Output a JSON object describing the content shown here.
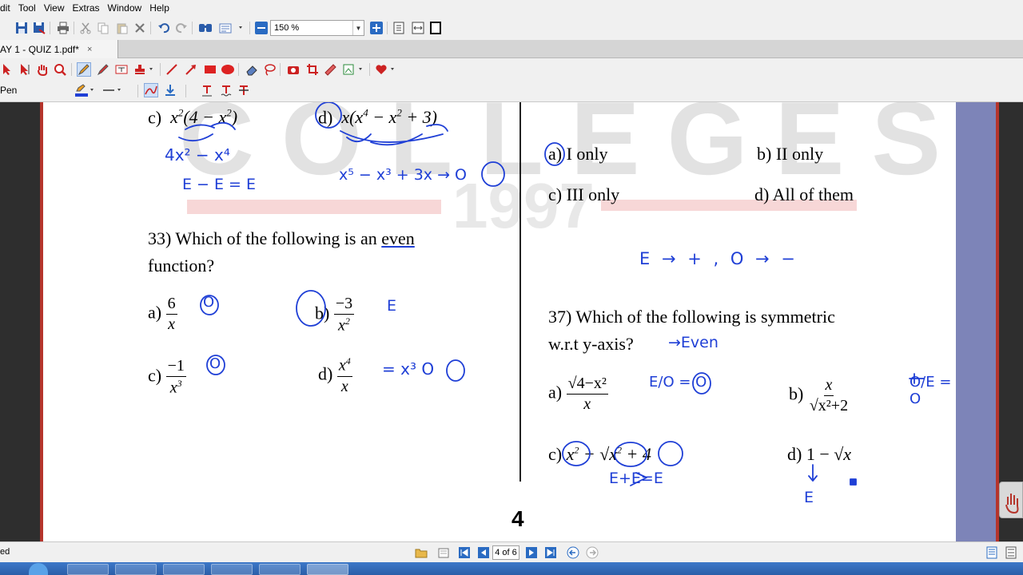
{
  "menu": [
    "Edit",
    "Tool",
    "View",
    "Extras",
    "Window",
    "Help"
  ],
  "menu_display": [
    "dit",
    "Tool",
    "View",
    "Extras",
    "Window",
    "Help"
  ],
  "zoom": "150 %",
  "tab": {
    "title": "AY 1 - QUIZ 1.pdf*",
    "close": "×"
  },
  "toolbar3": {
    "tool_label": "Pen"
  },
  "document": {
    "watermark_text": "COLLEGES",
    "watermark_year": "1997",
    "page_number": "4",
    "left": {
      "c_prev": "c)",
      "d_prev": "d)",
      "q33": "33) Which of the following is an",
      "q33_underlined": "even",
      "q33_line2": "function?",
      "a": "a)",
      "b": "b)",
      "c": "c)",
      "d": "d)",
      "a_num": "6",
      "b_num": "−3",
      "c_num": "−1",
      "d_num": "x",
      "hw_c_expand": "4x² − x⁴",
      "hw_c_parity": "E − E = E",
      "hw_d_expand": "x⁵ − x³ + 3x → O",
      "hw_a": "O",
      "hw_b": "E",
      "hw_c": "O",
      "hw_d": "= x³  O"
    },
    "right": {
      "opt_a": "a) I only",
      "opt_b": "b) II only",
      "opt_c": "c) III only",
      "opt_d": "d) All of them",
      "hw_rule": "E → +  , O → −",
      "q37": "37) Which of the following is symmetric",
      "q37_line2": "w.r.t y-axis?",
      "hw_even": "→Even",
      "a": "a)",
      "b": "b)",
      "c": "c)",
      "d": "d) 1 −",
      "a_num": "√4−x²",
      "a_den": "x",
      "b_num": "x",
      "b_den": "√x²+2",
      "hw_a": "E/O = O",
      "hw_b": "O/E = O",
      "hw_c": "E+E=E",
      "hw_d": "E"
    }
  },
  "status": {
    "left_text": "ed",
    "page_field": "4 of 6"
  },
  "colors": {
    "ink": "#1f3fd6",
    "accent_red": "#b5352c",
    "sidepanel": "#7d84b8"
  }
}
